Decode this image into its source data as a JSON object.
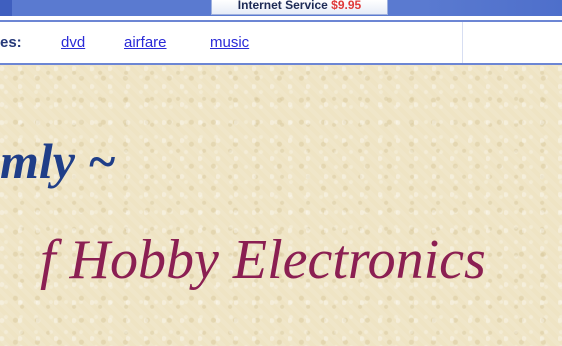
{
  "banner": {
    "ad_text": "Internet Service",
    "ad_price": "$9.95"
  },
  "nav": {
    "label": "es:",
    "links": [
      "dvd",
      "airfare",
      "music"
    ]
  },
  "content": {
    "heading_1": "mly ~",
    "heading_2": "f Hobby Electronics"
  },
  "colors": {
    "banner_blue": "#5a7ad0",
    "nav_border": "#6c86d4",
    "link_blue": "#2a2ad8",
    "heading_blue": "#1f3e88",
    "heading_maroon": "#8b1f52",
    "parchment": "#efe4c4"
  }
}
